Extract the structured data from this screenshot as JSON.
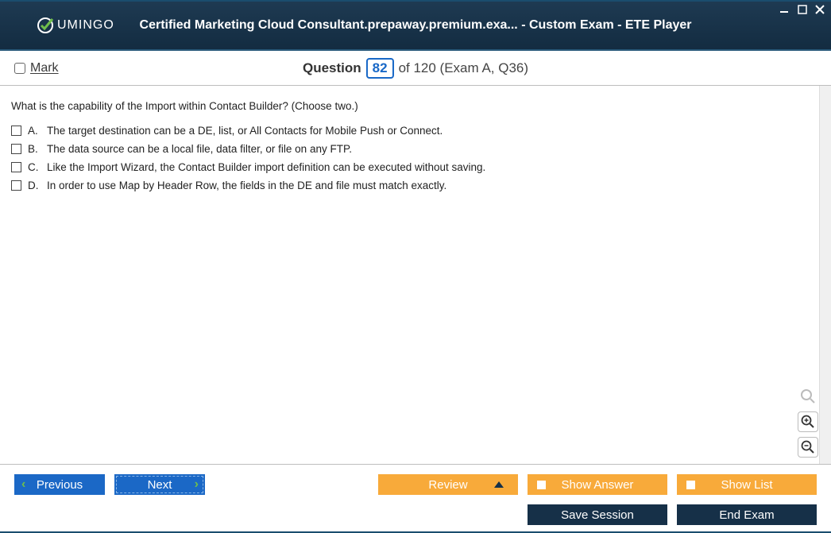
{
  "titlebar": {
    "logo_text": "UMINGO",
    "title": "Certified Marketing Cloud Consultant.prepaway.premium.exa... - Custom Exam - ETE Player"
  },
  "header": {
    "mark_label": "Mark",
    "question_label": "Question",
    "question_number": "82",
    "of_text": "of 120 (Exam A, Q36)"
  },
  "question": {
    "text": "What is the capability of the Import within Contact Builder? (Choose two.)",
    "answers": [
      {
        "letter": "A.",
        "text": "The target destination can be a DE, list, or All Contacts for Mobile Push or Connect."
      },
      {
        "letter": "B.",
        "text": "The data source can be a local file, data filter, or file on any FTP."
      },
      {
        "letter": "C.",
        "text": "Like the Import Wizard, the Contact Builder import definition can be executed without saving."
      },
      {
        "letter": "D.",
        "text": "In order to use Map by Header Row, the fields in the DE and file must match exactly."
      }
    ]
  },
  "buttons": {
    "previous": "Previous",
    "next": "Next",
    "review": "Review",
    "show_answer": "Show Answer",
    "show_list": "Show List",
    "save_session": "Save Session",
    "end_exam": "End Exam"
  }
}
